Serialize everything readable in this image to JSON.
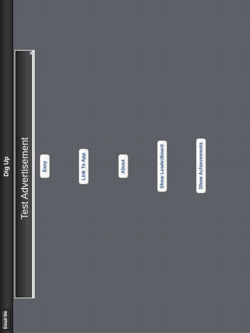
{
  "navbar": {
    "title": "Dig Up",
    "email_label": "Email Me"
  },
  "ad": {
    "text": "Test Advertisement"
  },
  "menu": {
    "easy": "Easy",
    "link_to_app": "Link To App",
    "about": "About",
    "show_leaderboard": "Show LeaderBoard",
    "show_achievements": "Show Achievements"
  },
  "colors": {
    "background": "#5d6066",
    "button_text": "#2e4e7e",
    "navbar": "#2a2a2a"
  }
}
